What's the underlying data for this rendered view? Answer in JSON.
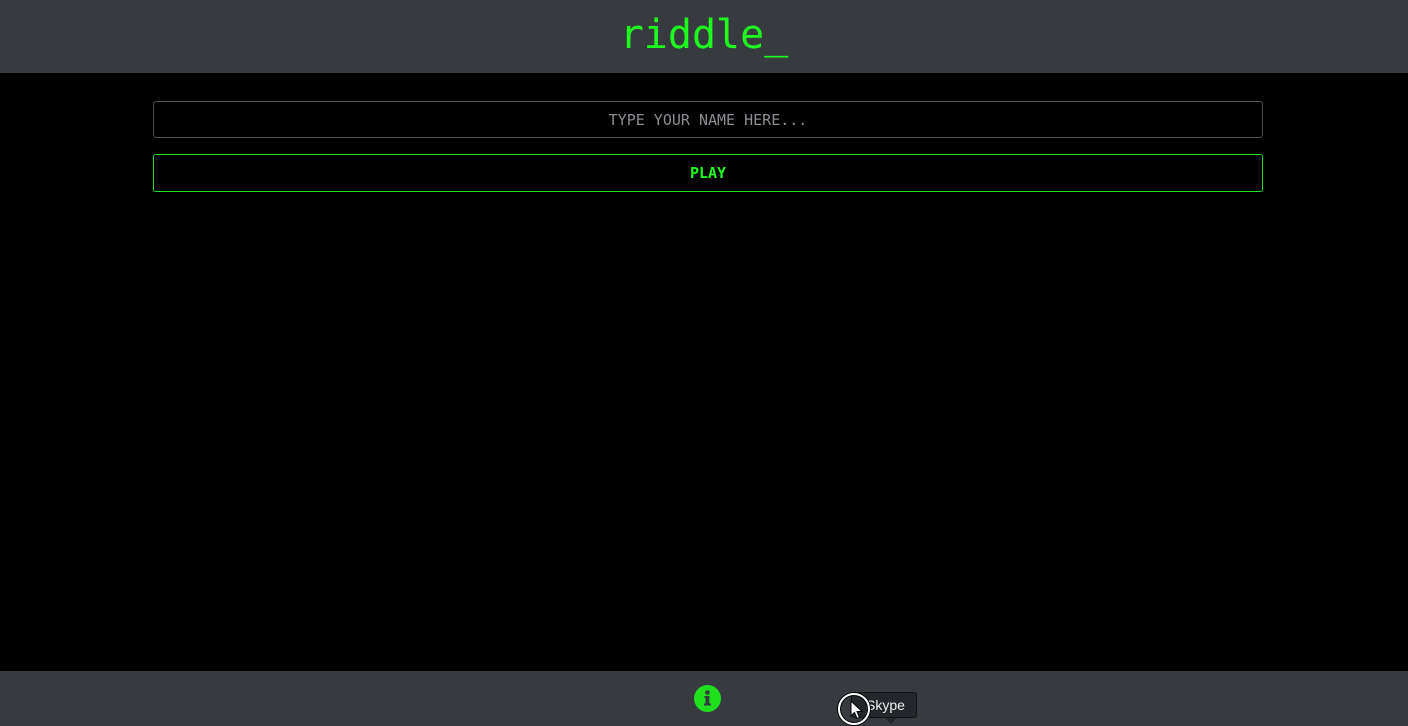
{
  "header": {
    "title": "riddle_"
  },
  "main": {
    "name_input": {
      "value": "",
      "placeholder": "TYPE YOUR NAME HERE..."
    },
    "play_label": "PLAY"
  },
  "footer": {
    "info_icon": "info-circle-icon",
    "tooltip_text": "Skype"
  },
  "colors": {
    "accent": "#1fff1f",
    "bar_background": "#373a3f",
    "page_background": "#000000"
  }
}
